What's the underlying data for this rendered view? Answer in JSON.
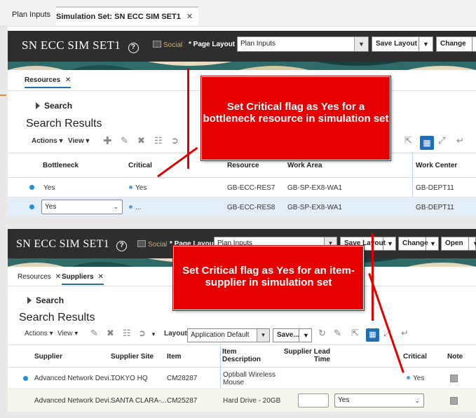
{
  "app_tabs": [
    {
      "label": "Plan Inputs"
    },
    {
      "label": "Simulation Set: SN ECC SIM SET1"
    }
  ],
  "header": {
    "title": "SN ECC SIM SET1",
    "help": "?",
    "social": "Social",
    "page_layout_label": "* Page Layout",
    "page_layout_value": "Plan Inputs",
    "save_layout": "Save Layout",
    "change": "Change",
    "open": "Open"
  },
  "panel1": {
    "subtab": "Resources",
    "search": "Search",
    "search_results": "Search Results",
    "actions": "Actions",
    "view": "View",
    "columns": [
      "Bottleneck",
      "Critical",
      "Resource",
      "Work Area",
      "Work Center"
    ],
    "rows": [
      {
        "bottleneck": "Yes",
        "critical": "Yes",
        "resource": "GB-ECC-RES7",
        "work_area": "GB-SP-EX8-WA1",
        "work_center": "GB-DEPT11"
      },
      {
        "bottleneck": "Yes",
        "critical": "...",
        "resource": "GB-ECC-RES8",
        "work_area": "GB-SP-EX8-WA1",
        "work_center": "GB-DEPT11"
      }
    ],
    "callout": "Set Critical flag as Yes for a bottleneck resource in simulation set"
  },
  "panel2": {
    "subtabs": [
      "Resources",
      "Suppliers"
    ],
    "search": "Search",
    "search_results": "Search Results",
    "actions": "Actions",
    "view": "View",
    "layout_label": "Layout",
    "layout_value": "Application Default",
    "save": "Save...",
    "columns": [
      "Supplier",
      "Supplier Site",
      "Item",
      "Item Description",
      "Supplier Lead Time",
      "Critical",
      "Note"
    ],
    "rows": [
      {
        "supplier": "Advanced Network Devi...",
        "site": "TOKYO HQ",
        "item": "CM28287",
        "desc": "Optiball Wireless Mouse",
        "lead": "",
        "critical": "Yes"
      },
      {
        "supplier": "Advanced Network Devi...",
        "site": "SANTA CLARA-...",
        "item": "CM25287",
        "desc": "Hard Drive - 20GB",
        "lead": "",
        "critical": "Yes"
      }
    ],
    "callout": "Set Critical flag as Yes for an item-supplier in simulation set"
  },
  "colors": {
    "accent": "#1f6fb5",
    "callout": "#e50000",
    "header": "#2e2e2e"
  }
}
